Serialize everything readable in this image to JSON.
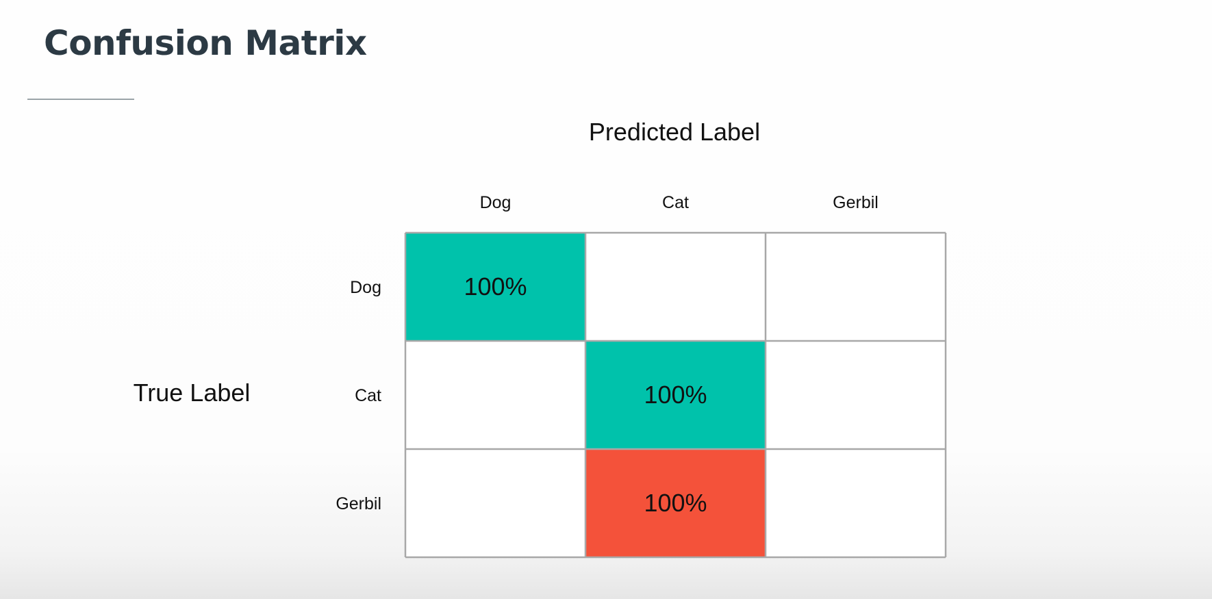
{
  "slide": {
    "title": "Confusion Matrix"
  },
  "chart_data": {
    "type": "heatmap",
    "title": "Confusion Matrix",
    "xlabel": "Predicted Label",
    "ylabel": "True Label",
    "x_categories": [
      "Dog",
      "Cat",
      "Gerbil"
    ],
    "y_categories": [
      "Dog",
      "Cat",
      "Gerbil"
    ],
    "cells": [
      {
        "row": "Dog",
        "col": "Dog",
        "value": 100,
        "label": "100%",
        "color": "#00c2ab"
      },
      {
        "row": "Cat",
        "col": "Cat",
        "value": 100,
        "label": "100%",
        "color": "#00c2ab"
      },
      {
        "row": "Gerbil",
        "col": "Cat",
        "value": 100,
        "label": "100%",
        "color": "#f4523a"
      }
    ],
    "grid": true,
    "colors": {
      "correct": "#00c2ab",
      "incorrect": "#f4523a",
      "empty": "#ffffff",
      "grid": "#a8a8a8"
    }
  }
}
